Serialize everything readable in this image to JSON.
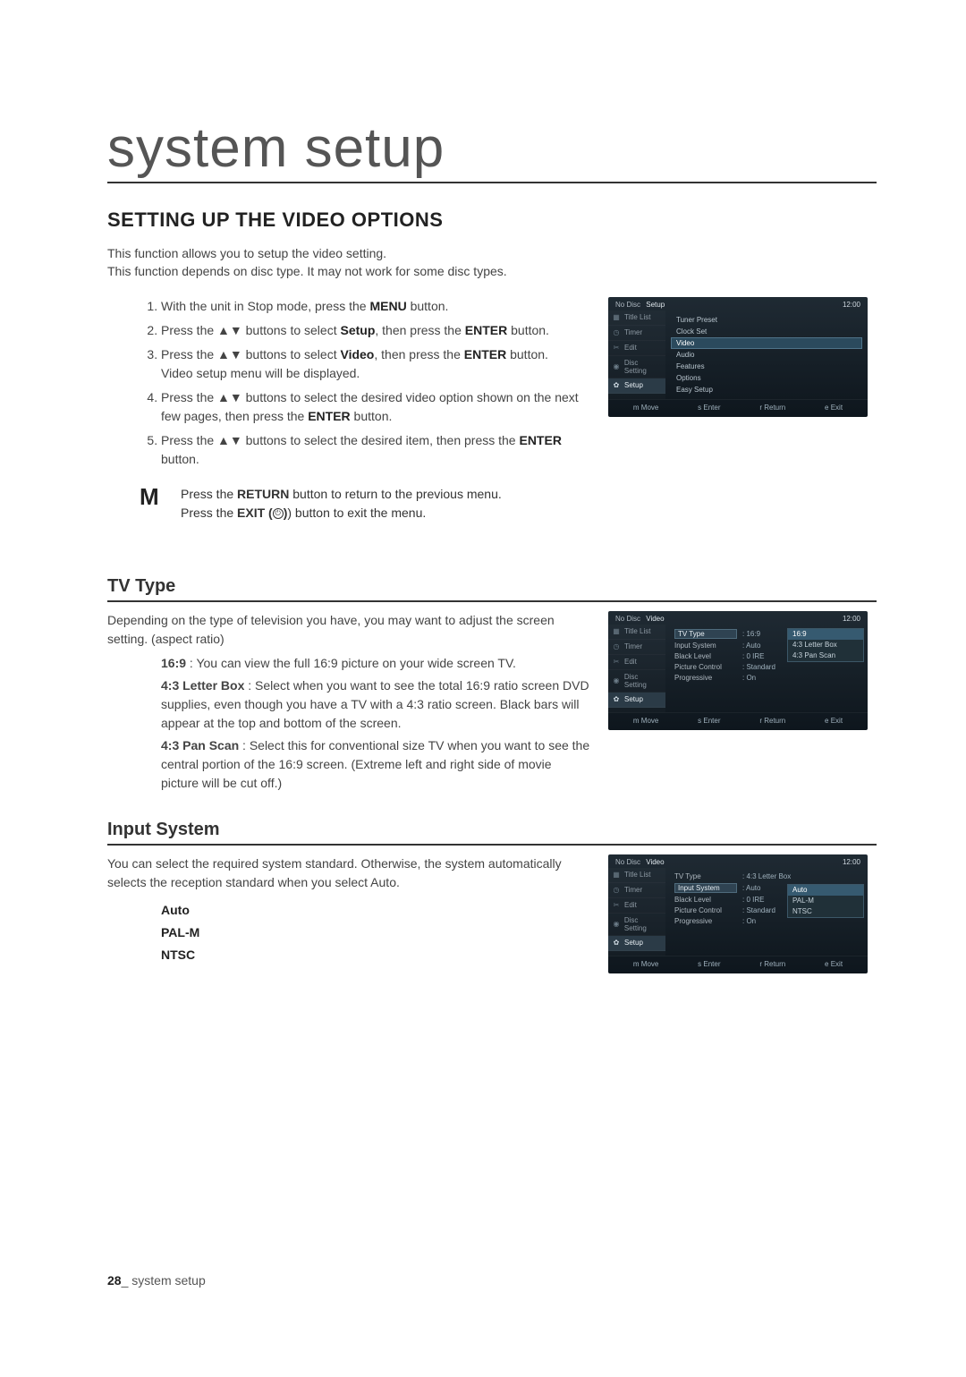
{
  "page": {
    "mega_title": "system setup",
    "section_title": "SETTING UP THE VIDEO OPTIONS",
    "intro_1": "This function allows you to setup the video setting.",
    "intro_2": "This function depends on disc type. It may not work for some disc types.",
    "footer_num": "28",
    "footer_sep": "_ ",
    "footer_text": "system setup"
  },
  "steps": {
    "s1_a": "With the unit in Stop mode, press the ",
    "s1_b": "MENU",
    "s1_c": " button.",
    "s2_a": "Press the ▲▼ buttons to select ",
    "s2_b": "Setup",
    "s2_c": ", then press the ",
    "s2_d": "ENTER",
    "s2_e": " button.",
    "s3_a": "Press the ▲▼ buttons to select ",
    "s3_b": "Video",
    "s3_c": ", then press the ",
    "s3_d": "ENTER",
    "s3_e": " button.",
    "s3_f": "Video setup menu will be displayed.",
    "s4_a": "Press the ▲▼ buttons to select the desired video option shown on the next few pages, then press the ",
    "s4_b": "ENTER",
    "s4_c": " button.",
    "s5_a": "Press the ▲▼ buttons to select the desired item, then press the ",
    "s5_b": "ENTER",
    "s5_c": " button."
  },
  "note": {
    "mark": "M",
    "l1_a": "Press the ",
    "l1_b": "RETURN",
    "l1_c": " button to return to the previous menu.",
    "l2_a": "Press the ",
    "l2_b": "EXIT (",
    "l2_c": ") button to exit the menu."
  },
  "tvtype": {
    "heading": "TV Type",
    "intro": "Depending on the type of television you have, you may want to adjust the screen setting. (aspect ratio)",
    "o1_k": "16:9",
    "o1_v": " : You can view the full 16:9 picture on your wide screen TV.",
    "o2_k": "4:3 Letter Box",
    "o2_v": " : Select when you want to see the total 16:9 ratio screen DVD supplies, even though you have a TV with a 4:3 ratio screen. Black bars will appear at the top and bottom of the screen.",
    "o3_k": "4:3 Pan Scan",
    "o3_v": " : Select this for conventional size TV when you want to see the central portion of the 16:9 screen. (Extreme left and right side of movie picture will be cut off.)"
  },
  "inputsys": {
    "heading": "Input System",
    "intro": "You can select the required system standard. Otherwise, the system automatically selects the reception standard when you select Auto.",
    "o1": "Auto",
    "o2": "PAL-M",
    "o3": "NTSC"
  },
  "osd_common": {
    "no_disc": "No Disc",
    "time": "12:00",
    "side": [
      "Title List",
      "Timer",
      "Edit",
      "Disc Setting",
      "Setup"
    ],
    "foot_move": "m  Move",
    "foot_enter": "s  Enter",
    "foot_return": "r  Return",
    "foot_exit": "e  Exit"
  },
  "osd1": {
    "crumb": "Setup",
    "items": [
      "Tuner Preset",
      "Clock Set",
      "Video",
      "Audio",
      "Features",
      "Options",
      "Easy Setup"
    ],
    "selected_index": 2
  },
  "osd2": {
    "crumb": "Video",
    "rows": [
      {
        "k": "TV Type",
        "v": ": 16:9",
        "sel": true
      },
      {
        "k": "Input System",
        "v": ": Auto"
      },
      {
        "k": "Black Level",
        "v": ": 0 IRE"
      },
      {
        "k": "Picture Control",
        "v": ": Standard"
      },
      {
        "k": "Progressive",
        "v": ": On"
      }
    ],
    "popup": [
      "16:9",
      "4:3 Letter Box",
      "4:3 Pan Scan"
    ],
    "popup_sel": 0
  },
  "osd3": {
    "crumb": "Video",
    "rows": [
      {
        "k": "TV Type",
        "v": ": 4:3 Letter Box"
      },
      {
        "k": "Input System",
        "v": ": Auto",
        "sel": true
      },
      {
        "k": "Black Level",
        "v": ": 0 IRE"
      },
      {
        "k": "Picture Control",
        "v": ": Standard"
      },
      {
        "k": "Progressive",
        "v": ": On"
      }
    ],
    "popup": [
      "Auto",
      "PAL-M",
      "NTSC"
    ],
    "popup_sel": 0
  }
}
